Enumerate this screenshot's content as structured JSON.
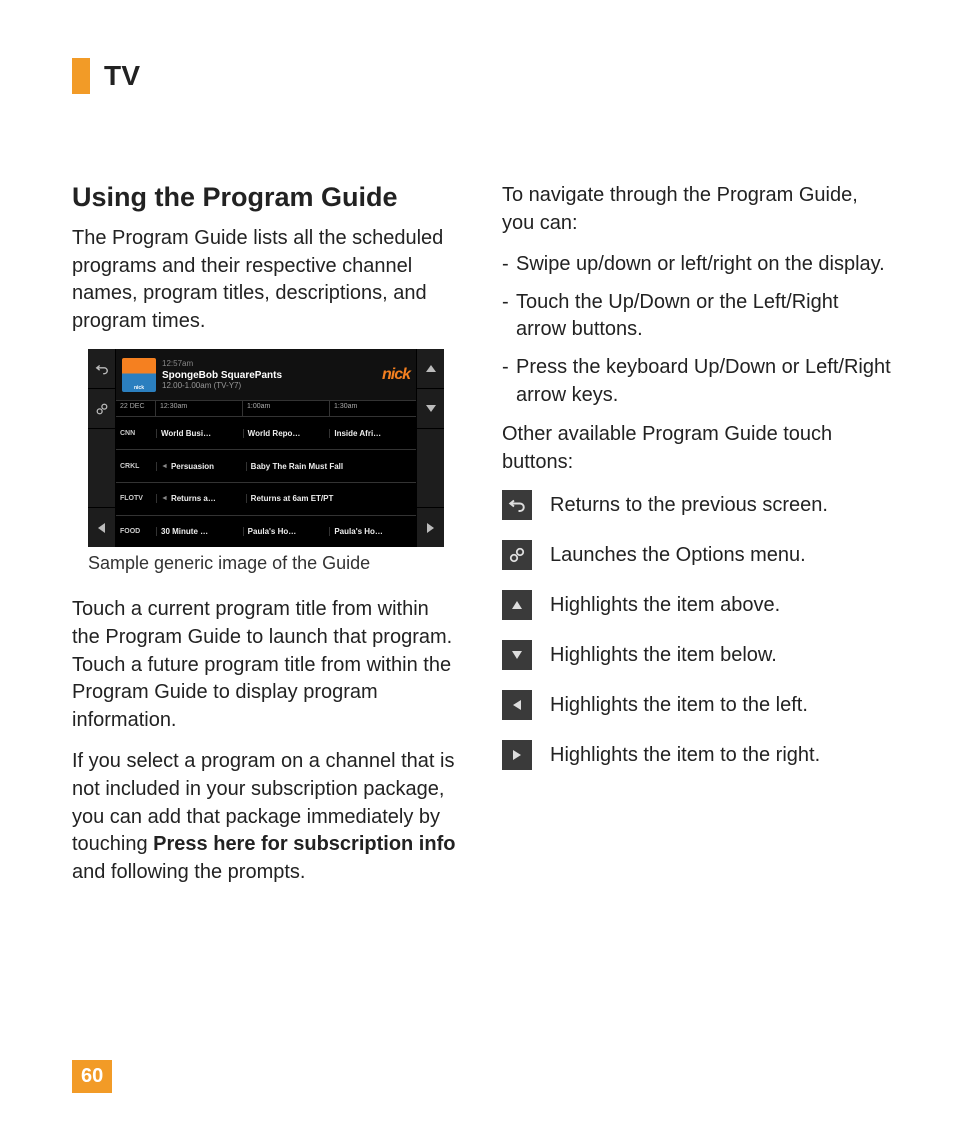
{
  "header": {
    "section": "TV"
  },
  "page_number": "60",
  "left": {
    "heading": "Using the Program Guide",
    "p1": "The Program Guide lists all the scheduled programs and their respective channel names, program titles, descriptions, and program times.",
    "caption": "Sample generic image of the Guide",
    "p2": "Touch a current program title from within the Program Guide to launch that program. Touch a future program title from within the Program Guide to display program information.",
    "p3_a": "If you select a program on a channel that is not included in your subscription package, you can add that package immediately by touching ",
    "p3_bold": "Press here for subscription info",
    "p3_b": " and following the prompts."
  },
  "right": {
    "intro": "To navigate through the Program Guide, you can:",
    "nav_items": [
      "Swipe up/down or left/right on the display.",
      "Touch the Up/Down or the Left/Right arrow buttons.",
      "Press the keyboard Up/Down or Left/Right arrow keys."
    ],
    "other": "Other available Program Guide touch buttons:",
    "legend": [
      {
        "icon": "back",
        "text": "Returns to the previous screen."
      },
      {
        "icon": "options",
        "text": "Launches the Options menu."
      },
      {
        "icon": "up",
        "text": "Highlights the item above."
      },
      {
        "icon": "down",
        "text": "Highlights the item below."
      },
      {
        "icon": "left",
        "text": "Highlights the item to the left."
      },
      {
        "icon": "right",
        "text": "Highlights the item to the right."
      }
    ]
  },
  "guide_shot": {
    "clock": "12:57am",
    "hero": {
      "channel_logo_small": "nick",
      "title": "SpongeBob SquarePants",
      "subtitle": "12.00-1.00am (TV-Y7)",
      "logo_big": "nick"
    },
    "time_header": {
      "date": "22 DEC",
      "slots": [
        "12:30am",
        "1:00am",
        "1:30am"
      ]
    },
    "rows": [
      {
        "channel": "CNN",
        "cells": [
          "World Busi…",
          "World Repo…",
          "Inside Afri…"
        ]
      },
      {
        "channel": "CRKL",
        "cells": [
          "Persuasion",
          "Baby The Rain Must Fall"
        ],
        "leading_arrow": true,
        "span_last": true
      },
      {
        "channel": "FLOTV",
        "cells": [
          "Returns a…",
          "Returns at 6am ET/PT"
        ],
        "leading_arrow": true,
        "span_last": true
      },
      {
        "channel": "FOOD",
        "cells": [
          "30 Minute …",
          "Paula's Ho…",
          "Paula's Ho…"
        ]
      }
    ]
  }
}
